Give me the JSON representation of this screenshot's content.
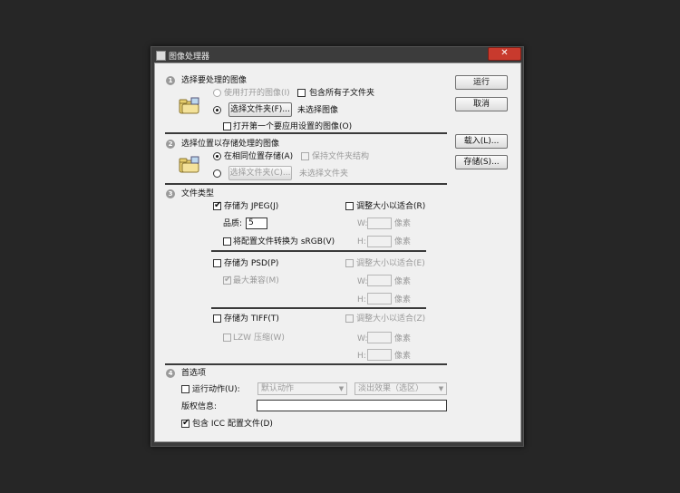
{
  "window": {
    "title": "图像处理器",
    "close_glyph": "✕"
  },
  "buttons": {
    "run": "运行",
    "cancel": "取消",
    "load": "载入(L)...",
    "save": "存储(S)..."
  },
  "section1": {
    "number": "1",
    "heading": "选择要处理的图像",
    "use_open": "使用打开的图像(I)",
    "include_subfolders": "包含所有子文件夹",
    "choose_folder_btn": "选择文件夹(F)...",
    "folder_status": "未选择图像",
    "open_first": "打开第一个要应用设置的图像(O)"
  },
  "section2": {
    "number": "2",
    "heading": "选择位置以存储处理的图像",
    "same_location": "在相同位置存储(A)",
    "keep_structure": "保持文件夹结构",
    "choose_folder_btn": "选择文件夹(C)...",
    "folder_status": "未选择文件夹"
  },
  "section3": {
    "number": "3",
    "heading": "文件类型",
    "jpeg": {
      "save_as": "存储为 JPEG(J)",
      "resize": "调整大小以适合(R)",
      "quality_label": "品质:",
      "quality_value": "5",
      "w": "W:",
      "h": "H:",
      "px": "像素",
      "convert": "将配置文件转换为 sRGB(V)"
    },
    "psd": {
      "save_as": "存储为 PSD(P)",
      "resize": "调整大小以适合(E)",
      "max_compat": "最大兼容(M)",
      "w": "W:",
      "h": "H:",
      "px": "像素"
    },
    "tiff": {
      "save_as": "存储为 TIFF(T)",
      "resize": "调整大小以适合(Z)",
      "lzw": "LZW 压缩(W)",
      "w": "W:",
      "h": "H:",
      "px": "像素"
    }
  },
  "section4": {
    "number": "4",
    "heading": "首选项",
    "run_action": "运行动作(U):",
    "action_set": "默认动作",
    "action": "淡出效果（选区）",
    "copyright_label": "版权信息:",
    "copyright_value": "",
    "include_icc": "包含 ICC 配置文件(D)"
  },
  "checks": {
    "tick": "✔",
    "dropdown_arrow": "▼"
  },
  "colors": {
    "background": "#262626",
    "panel": "#f0f0f0",
    "close": "#c83a2d",
    "disabled": "#9a9a9a"
  }
}
